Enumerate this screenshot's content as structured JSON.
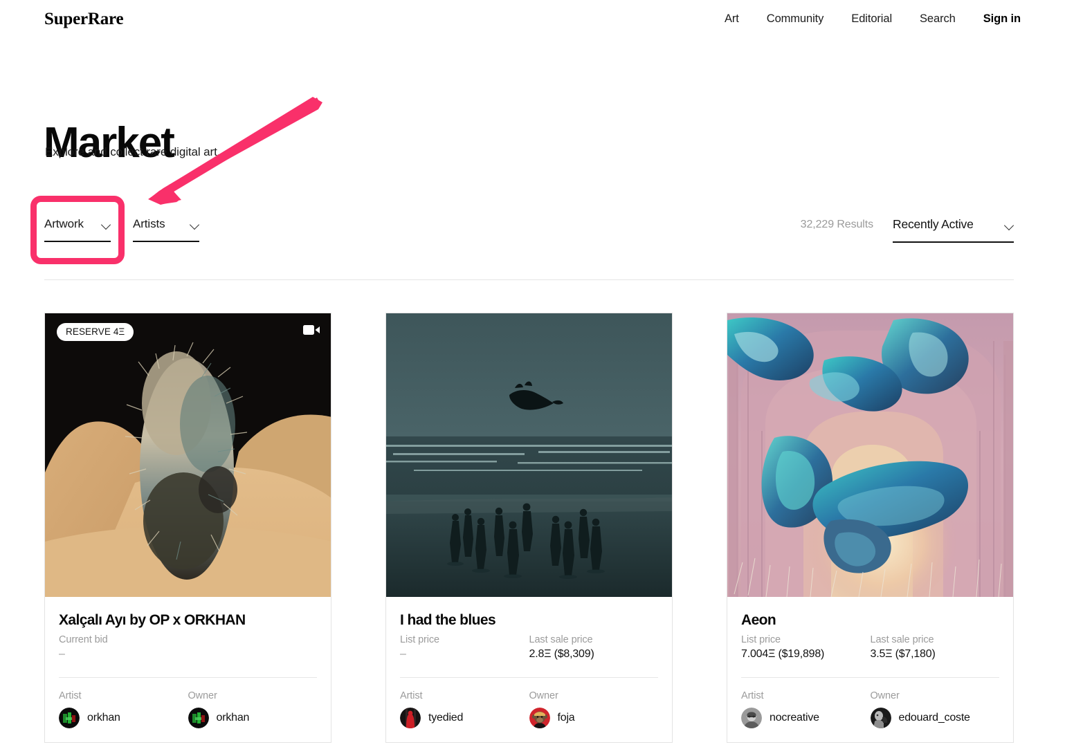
{
  "header": {
    "logo": "SuperRare",
    "nav": [
      {
        "label": "Art",
        "strong": false
      },
      {
        "label": "Community",
        "strong": false
      },
      {
        "label": "Editorial",
        "strong": false
      },
      {
        "label": "Search",
        "strong": false
      },
      {
        "label": "Sign in",
        "strong": true
      }
    ]
  },
  "page": {
    "title": "Market",
    "subtitle": "Explore and collect rare digital art."
  },
  "filters": {
    "artwork": {
      "label": "Artwork",
      "icon": "chevron-down-icon"
    },
    "artists": {
      "label": "Artists",
      "icon": "chevron-down-icon"
    },
    "results_count": "32,229 Results",
    "sort": {
      "label": "Recently Active",
      "icon": "chevron-down-icon"
    }
  },
  "annotation": {
    "color": "#f9306a",
    "arrow": "pink-arrow-pointing-to-artwork-filter",
    "highlight": "pink-rounded-rect-around-artwork-filter"
  },
  "cards": [
    {
      "badge": "RESERVE 4Ξ",
      "has_video_icon": true,
      "title": "Xalçalı Ayı by OP x ORKHAN",
      "price_left_label": "Current bid",
      "price_left_value": "–",
      "price_right_label": "",
      "price_right_value": "",
      "artist_label": "Artist",
      "artist_name": "orkhan",
      "owner_label": "Owner",
      "owner_name": "orkhan"
    },
    {
      "badge": "",
      "has_video_icon": false,
      "title": "I had the blues",
      "price_left_label": "List price",
      "price_left_value": "–",
      "price_right_label": "Last sale price",
      "price_right_value": "2.8Ξ ($8,309)",
      "artist_label": "Artist",
      "artist_name": "tyedied",
      "owner_label": "Owner",
      "owner_name": "foja"
    },
    {
      "badge": "",
      "has_video_icon": false,
      "title": "Aeon",
      "price_left_label": "List price",
      "price_left_value": "7.004Ξ ($19,898)",
      "price_right_label": "Last sale price",
      "price_right_value": "3.5Ξ ($7,180)",
      "artist_label": "Artist",
      "artist_name": "nocreative",
      "owner_label": "Owner",
      "owner_name": "edouard_coste"
    }
  ]
}
